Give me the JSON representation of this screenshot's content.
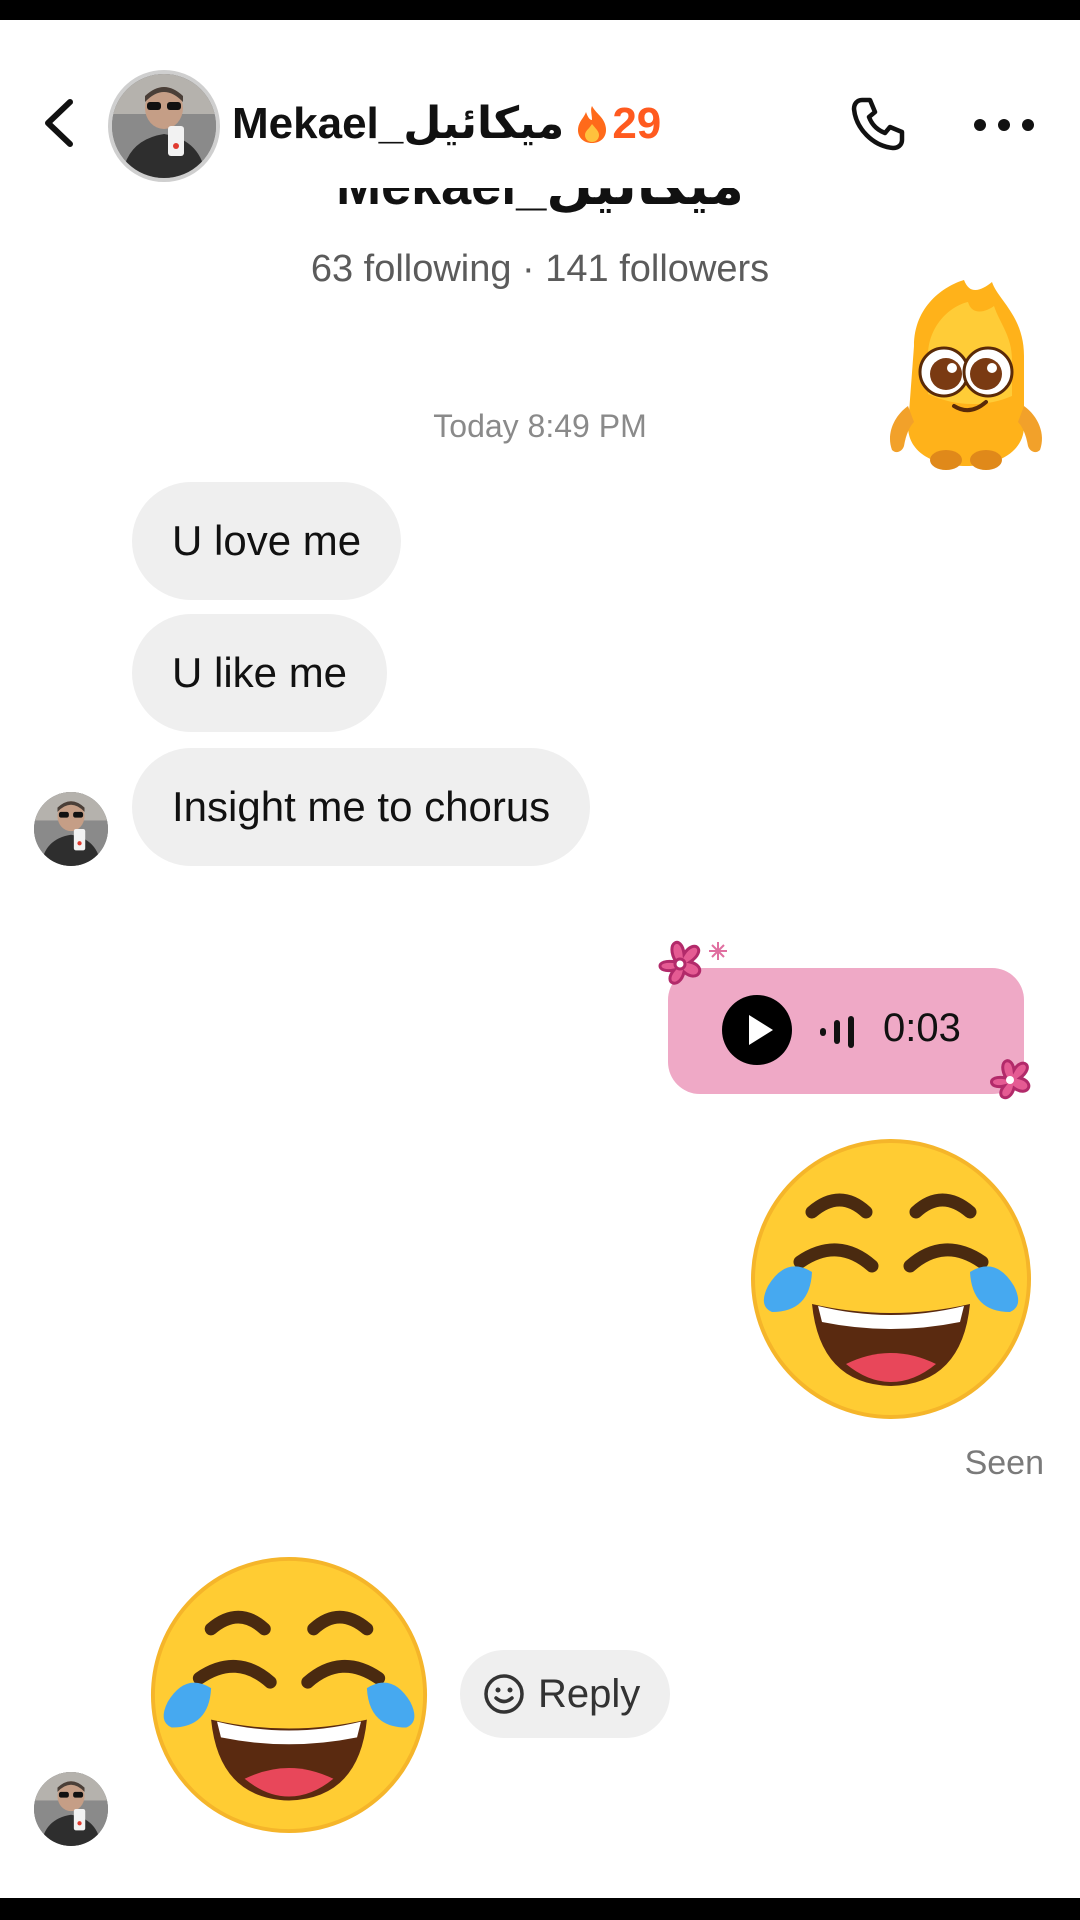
{
  "header": {
    "username": "Mekael_ميكائيل",
    "streak_count": "29",
    "streak_icon": "fire-icon"
  },
  "profile": {
    "name_partial": "Mekael_ميكائيل",
    "stats": "63 following · 141 followers"
  },
  "chat": {
    "timestamp": "Today 8:49 PM",
    "incoming": [
      {
        "text": "U love me"
      },
      {
        "text": "U like me"
      },
      {
        "text": "Insight me to chorus"
      }
    ],
    "voice_message": {
      "duration": "0:03"
    },
    "seen_label": "Seen",
    "reply_label": "Reply"
  },
  "colors": {
    "bubble_bg": "#efefef",
    "voice_bg": "#efa9c6",
    "streak": "#ff5a1f",
    "emoji_yellow": "#ffcc33"
  }
}
